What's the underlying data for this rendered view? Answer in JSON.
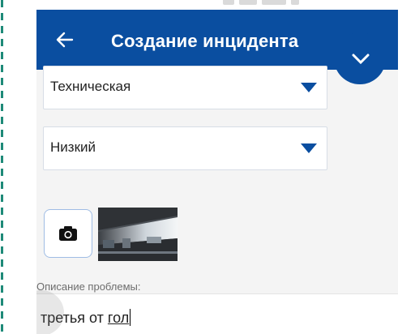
{
  "colors": {
    "appbar": "#0a4ea0",
    "accent_dash": "#1e8a78",
    "background": "#f4f4f4"
  },
  "appbar": {
    "title": "Создание инцидента",
    "back_icon": "arrow-left-icon"
  },
  "form": {
    "category": {
      "value": "Техническая",
      "icon": "triangle-down-icon"
    },
    "priority": {
      "value": "Низкий",
      "icon": "triangle-down-icon"
    },
    "attachments": {
      "camera_icon": "camera-icon",
      "photo_count": 1
    },
    "description": {
      "label": "Описание проблемы:",
      "value_prefix": "третья от ",
      "value_composing": "гол"
    }
  }
}
